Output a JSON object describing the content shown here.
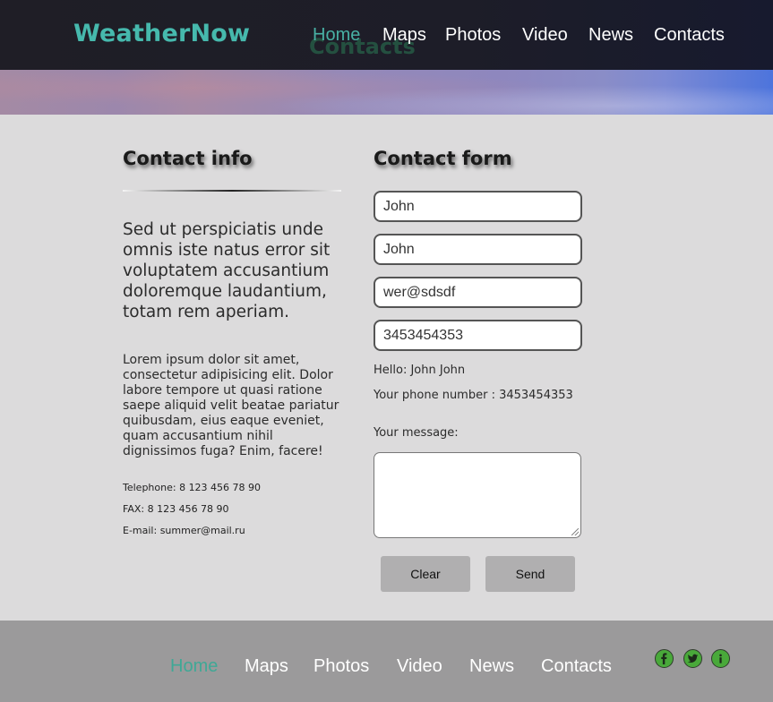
{
  "header": {
    "logo": "WeatherNow",
    "page_title": "Contacts",
    "nav": [
      "Home",
      "Maps",
      "Photos",
      "Video",
      "News",
      "Contacts"
    ],
    "active": "Home"
  },
  "contact_info": {
    "heading": "Contact info",
    "lead": "Sed ut perspiciatis unde omnis iste natus error sit voluptatem accusantium doloremque laudantium, totam rem aperiam.",
    "body": "Lorem ipsum dolor sit amet, consectetur adipisicing elit. Dolor labore tempore ut quasi ratione saepe aliquid velit beatae pariatur quibusdam, eius eaque eveniet, quam accusantium nihil dignissimos fuga? Enim, facere!",
    "telephone": "Telephone: 8 123 456 78 90",
    "fax": "FAX: 8 123 456 78 90",
    "email": "E-mail: summer@mail.ru"
  },
  "contact_form": {
    "heading": "Contact form",
    "first_name": "John",
    "last_name": "John",
    "email": "wer@sdsdf",
    "phone": "3453454353",
    "greeting": "Hello: John John",
    "phone_echo": "Your phone number : 3453454353",
    "message_label": "Your message:",
    "message": "",
    "clear_label": "Clear",
    "send_label": "Send"
  },
  "footer": {
    "nav": [
      "Home",
      "Maps",
      "Photos",
      "Video",
      "News",
      "Contacts"
    ],
    "active": "Home",
    "social": [
      "facebook-icon",
      "twitter-icon",
      "info-icon"
    ]
  },
  "colors": {
    "accent": "#46b9ad",
    "header_bg": "#1d1d28",
    "page_bg": "#dcdbdc",
    "footer_bg": "#9b9a9b",
    "social_green": "#49a93a"
  }
}
